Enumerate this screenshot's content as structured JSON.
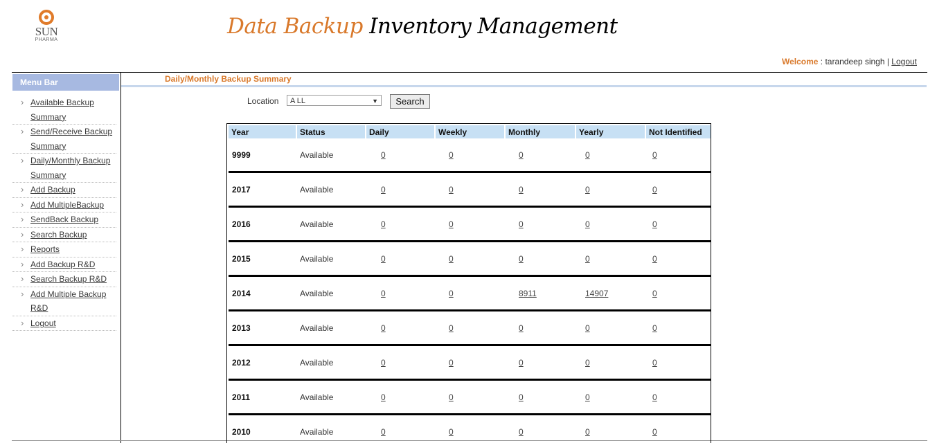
{
  "logo": {
    "name": "SUN",
    "sub": "PHARMA"
  },
  "header": {
    "title_part1": "Data Backup",
    "title_part2": "Inventory Management"
  },
  "user": {
    "welcome_label": "Welcome",
    "name": " : tarandeep singh | ",
    "logout": "Logout"
  },
  "sidebar": {
    "header": "Menu Bar",
    "items": [
      {
        "label": "Available Backup Summary"
      },
      {
        "label": "Send/Receive Backup Summary"
      },
      {
        "label": "Daily/Monthly Backup Summary"
      },
      {
        "label": "Add Backup"
      },
      {
        "label": "Add MultipleBackup"
      },
      {
        "label": "SendBack Backup"
      },
      {
        "label": "Search Backup"
      },
      {
        "label": "Reports"
      },
      {
        "label": "Add Backup R&D"
      },
      {
        "label": "Search Backup R&D"
      },
      {
        "label": "Add Multiple Backup R&D"
      },
      {
        "label": "Logout"
      }
    ]
  },
  "page": {
    "heading": "Daily/Monthly Backup Summary"
  },
  "filter": {
    "location_label": "Location",
    "location_value": "A LL",
    "search_label": "Search"
  },
  "table": {
    "headers": [
      "Year",
      "Status",
      "Daily",
      "Weekly",
      "Monthly",
      "Yearly",
      "Not Identified"
    ],
    "rows": [
      [
        "9999",
        "Available",
        "0",
        "0",
        "0",
        "0",
        "0"
      ],
      [
        "2017",
        "Available",
        "0",
        "0",
        "0",
        "0",
        "0"
      ],
      [
        "2016",
        "Available",
        "0",
        "0",
        "0",
        "0",
        "0"
      ],
      [
        "2015",
        "Available",
        "0",
        "0",
        "0",
        "0",
        "0"
      ],
      [
        "2014",
        "Available",
        "0",
        "0",
        "8911",
        "14907",
        "0"
      ],
      [
        "2013",
        "Available",
        "0",
        "0",
        "0",
        "0",
        "0"
      ],
      [
        "2012",
        "Available",
        "0",
        "0",
        "0",
        "0",
        "0"
      ],
      [
        "2011",
        "Available",
        "0",
        "0",
        "0",
        "0",
        "0"
      ],
      [
        "2010",
        "Available",
        "0",
        "0",
        "0",
        "0",
        "0"
      ]
    ]
  },
  "colors": {
    "accent": "#d9792b",
    "menu_header": "#a7b9e1",
    "table_header": "#c7e0f4"
  }
}
